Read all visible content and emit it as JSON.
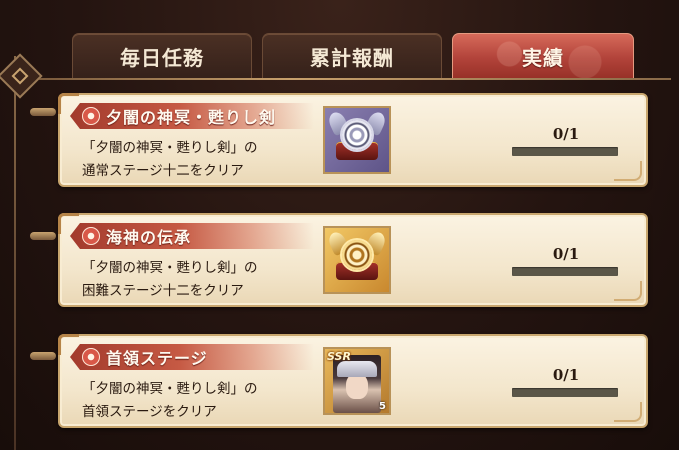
{
  "tabs": [
    {
      "label": "毎日任務",
      "active": false
    },
    {
      "label": "累計報酬",
      "active": false
    },
    {
      "label": "実績",
      "active": true
    }
  ],
  "achievements": [
    {
      "title": "夕闇の神冥・甦りし剣",
      "description_line1": "「夕闇の神冥・甦りし剣」の",
      "description_line2": "通常ステージ十二をクリア",
      "reward_icon": "silver-crest-icon",
      "progress_text": "0/1",
      "progress_fraction": 0
    },
    {
      "title": "海神の伝承",
      "description_line1": "「夕闇の神冥・甦りし剣」の",
      "description_line2": "困難ステージ十二をクリア",
      "reward_icon": "gold-crest-icon",
      "progress_text": "0/1",
      "progress_fraction": 0
    },
    {
      "title": "首領ステージ",
      "description_line1": "「夕闇の神冥・甦りし剣」の",
      "description_line2": "首領ステージをクリア",
      "reward_icon": "character-portrait-icon",
      "reward_rarity": "SSR",
      "reward_count": "5",
      "progress_text": "0/1",
      "progress_fraction": 0
    }
  ],
  "colors": {
    "active_tab": "#b2433a",
    "inactive_tab": "#3f281f",
    "card_bg": "#f6ebd4",
    "title_banner": "#c65a44",
    "progress_track": "#5a5648"
  }
}
